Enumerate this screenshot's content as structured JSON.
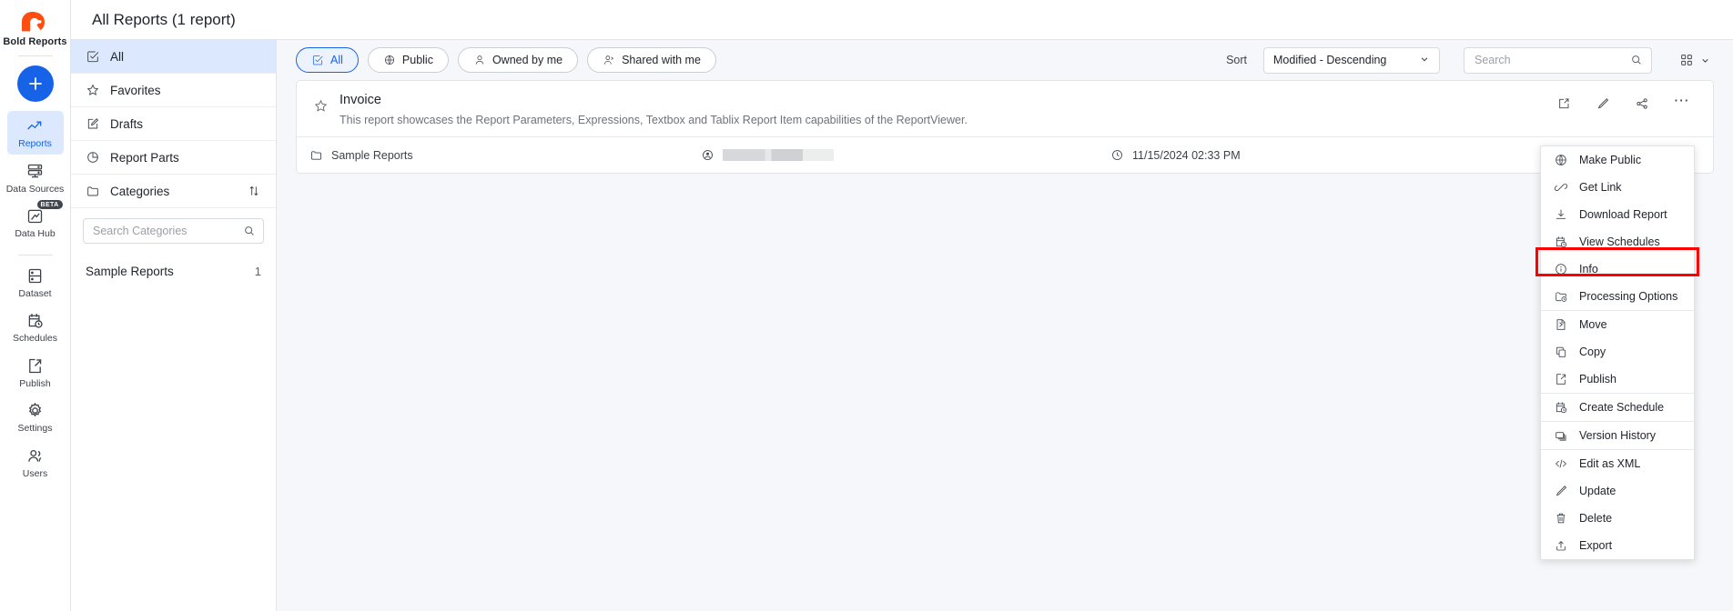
{
  "brand": {
    "name": "Bold Reports",
    "logo_icon": "bold-reports-logo"
  },
  "rail": {
    "add_label": "+",
    "items": [
      {
        "label": "Reports",
        "icon": "trending-up-icon",
        "active": true
      },
      {
        "label": "Data Sources",
        "icon": "server-icon",
        "active": false
      },
      {
        "label": "Data Hub",
        "icon": "data-hub-icon",
        "badge": "BETA",
        "active": false
      },
      {
        "label": "Dataset",
        "icon": "dataset-icon",
        "active": false
      },
      {
        "label": "Schedules",
        "icon": "calendar-clock-icon",
        "active": false
      },
      {
        "label": "Publish",
        "icon": "publish-icon",
        "active": false
      },
      {
        "label": "Settings",
        "icon": "gear-icon",
        "active": false
      },
      {
        "label": "Users",
        "icon": "users-icon",
        "active": false
      }
    ]
  },
  "header": {
    "title": "All Reports (1 report)"
  },
  "sidebar": {
    "items": [
      {
        "label": "All",
        "icon": "checkbox-check-icon",
        "active": true
      },
      {
        "label": "Favorites",
        "icon": "star-icon",
        "active": false
      },
      {
        "label": "Drafts",
        "icon": "draft-edit-icon",
        "active": false
      },
      {
        "label": "Report Parts",
        "icon": "pie-chart-icon",
        "active": false
      },
      {
        "label": "Categories",
        "icon": "folder-icon",
        "active": false,
        "sort_icon": "sort-arrows-icon"
      }
    ],
    "search": {
      "placeholder": "Search Categories",
      "value": "",
      "icon": "search-icon"
    },
    "categories": [
      {
        "label": "Sample Reports",
        "count": "1"
      }
    ]
  },
  "toolbar": {
    "chips": [
      {
        "label": "All",
        "icon": "checkbox-check-icon",
        "active": true
      },
      {
        "label": "Public",
        "icon": "globe-icon",
        "active": false
      },
      {
        "label": "Owned by me",
        "icon": "person-icon",
        "active": false
      },
      {
        "label": "Shared with me",
        "icon": "person-share-icon",
        "active": false
      }
    ],
    "sort_label": "Sort",
    "sort_value": "Modified - Descending",
    "sort_caret_icon": "chevron-down-icon",
    "search": {
      "placeholder": "Search",
      "value": "",
      "icon": "search-icon"
    },
    "view_mode_icon": "grid-view-icon",
    "view_mode_caret_icon": "chevron-down-icon"
  },
  "report_card": {
    "star_icon": "star-outline-icon",
    "title": "Invoice",
    "description": "This report showcases the Report Parameters, Expressions, Textbox and Tablix Report Item capabilities of the ReportViewer.",
    "actions": [
      {
        "name": "open-external",
        "icon": "external-link-icon"
      },
      {
        "name": "edit",
        "icon": "pencil-icon"
      },
      {
        "name": "share",
        "icon": "share-icon"
      },
      {
        "name": "more",
        "icon": "more-horizontal-icon"
      }
    ],
    "folder": {
      "icon": "folder-icon",
      "label": "Sample Reports"
    },
    "owner": {
      "icon": "owner-avatar-icon",
      "label": ""
    },
    "modified": {
      "icon": "clock-icon",
      "label": "11/15/2024 02:33 PM"
    }
  },
  "context_menu": {
    "highlight_color": "#ff0000",
    "highlighted_item": "Info",
    "groups": [
      [
        {
          "label": "Make Public",
          "icon": "globe-icon"
        },
        {
          "label": "Get Link",
          "icon": "link-icon"
        },
        {
          "label": "Download Report",
          "icon": "download-icon"
        },
        {
          "label": "View Schedules",
          "icon": "calendar-clock-icon"
        },
        {
          "label": "Info",
          "icon": "info-circle-icon"
        },
        {
          "label": "Processing Options",
          "icon": "folder-clock-icon"
        }
      ],
      [
        {
          "label": "Move",
          "icon": "move-file-icon"
        },
        {
          "label": "Copy",
          "icon": "copy-icon"
        },
        {
          "label": "Publish",
          "icon": "publish-icon"
        }
      ],
      [
        {
          "label": "Create Schedule",
          "icon": "calendar-clock-icon"
        }
      ],
      [
        {
          "label": "Version History",
          "icon": "layers-icon"
        }
      ],
      [
        {
          "label": "Edit as XML",
          "icon": "code-icon"
        },
        {
          "label": "Update",
          "icon": "pencil-icon"
        },
        {
          "label": "Delete",
          "icon": "trash-icon"
        },
        {
          "label": "Export",
          "icon": "export-icon"
        }
      ]
    ]
  }
}
